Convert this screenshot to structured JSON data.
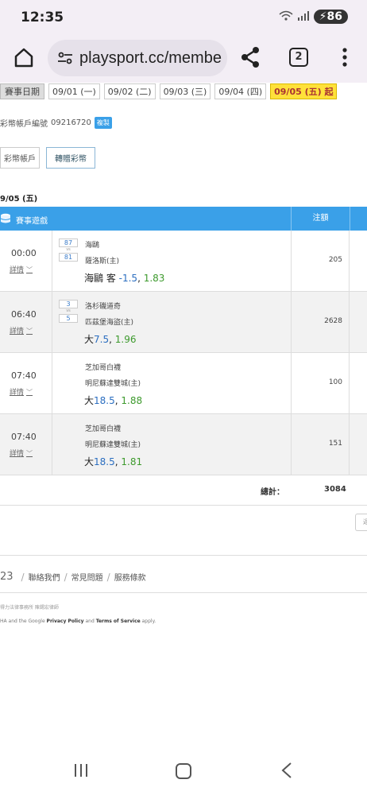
{
  "status": {
    "time": "12:35",
    "battery": "86"
  },
  "browser": {
    "url": "playsport.cc/membe",
    "tab_count": "2"
  },
  "dates": {
    "label": "賽事日期",
    "items": [
      "09/01 (一)",
      "09/02 (二)",
      "09/03 (三)",
      "09/04 (四)",
      "09/05 (五) 起"
    ],
    "selected_index": 4
  },
  "account": {
    "label": "彩幣帳戶編號",
    "number": "09216720",
    "copy_label": "複製"
  },
  "tabs": {
    "wallet": "彩幣帳戶",
    "transfer": "轉贈彩幣"
  },
  "day_heading": "9/05 (五)",
  "table": {
    "header_games": "賽事遊戲",
    "header_amount": "注額",
    "details_label": "詳情",
    "rows": [
      {
        "time": "00:00",
        "score_away": "87",
        "score_home": "81",
        "vs": "vs",
        "away": "海鷗",
        "home": "薩洛斯(主)",
        "pick_prefix": "海鷗 客",
        "pick_line": "-1.5",
        "pick_odds": "1.83",
        "amount": "205"
      },
      {
        "time": "06:40",
        "score_away": "3",
        "score_home": "5",
        "vs": "vs",
        "away": "洛杉磯道奇",
        "home": "匹茲堡海盜(主)",
        "pick_prefix": "大",
        "pick_line": "7.5",
        "pick_odds": "1.96",
        "amount": "2628"
      },
      {
        "time": "07:40",
        "score_away": "",
        "score_home": "",
        "vs": "",
        "away": "芝加哥白襪",
        "home": "明尼蘇達雙城(主)",
        "pick_prefix": "大",
        "pick_line": "18.5",
        "pick_odds": "1.88",
        "amount": "100"
      },
      {
        "time": "07:40",
        "score_away": "",
        "score_home": "",
        "vs": "",
        "away": "芝加哥白襪",
        "home": "明尼蘇達雙城(主)",
        "pick_prefix": "大",
        "pick_line": "18.5",
        "pick_odds": "1.81",
        "amount": "151"
      }
    ],
    "total_label": "總計：",
    "total_value": "3084"
  },
  "side_button": "返",
  "footer": {
    "year": "23",
    "links": [
      "聯絡我們",
      "常見問題",
      "服務條款"
    ],
    "legal": "得力法律事務所 陳錫宏律師",
    "recaptcha_pre": "HA and the Google ",
    "privacy": "Privacy Policy",
    "and": " and ",
    "terms": "Terms of Service",
    "apply": " apply."
  }
}
